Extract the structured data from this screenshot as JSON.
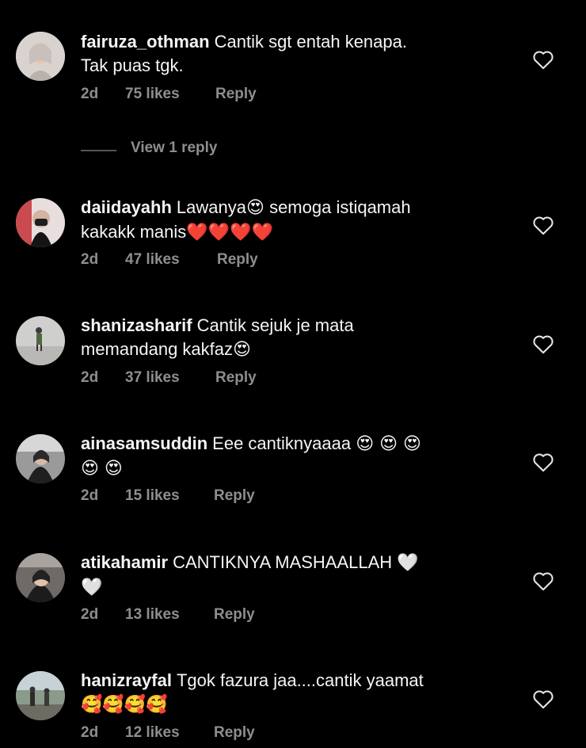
{
  "comments": [
    {
      "username": "fairuza_othman",
      "text_before": "Cantik sgt entah kenapa.",
      "text_after": "Tak puas tgk.",
      "emoji_inline": "",
      "emoji_tail": "",
      "time": "2d",
      "likes": "75 likes",
      "reply": "Reply",
      "avatar_icon": "profile-photo",
      "like_icon": "heart-outline-icon"
    },
    {
      "username": "daiidayahh",
      "text_before": "Lawanya",
      "emoji_inline": "😍",
      "text_after": "semoga istiqamah",
      "line2_text": "kakakk manis",
      "emoji_tail": "❤️❤️❤️❤️",
      "time": "2d",
      "likes": "47 likes",
      "reply": "Reply",
      "avatar_icon": "profile-photo",
      "like_icon": "heart-outline-icon"
    },
    {
      "username": "shanizasharif",
      "text_before": "Cantik sejuk je mata",
      "line2_text": "memandang kakfaz",
      "emoji_tail": "😍",
      "time": "2d",
      "likes": "37 likes",
      "reply": "Reply",
      "avatar_icon": "profile-photo",
      "like_icon": "heart-outline-icon"
    },
    {
      "username": "ainasamsuddin",
      "text_before": "Eee cantiknyaaaa",
      "emoji_inline": "😍 😍 😍",
      "emoji_tail": "😍 😍",
      "time": "2d",
      "likes": "15 likes",
      "reply": "Reply",
      "avatar_icon": "profile-photo",
      "like_icon": "heart-outline-icon"
    },
    {
      "username": "atikahamir",
      "text_before": "CANTIKNYA MASHAALLAH",
      "emoji_inline": "🤍",
      "emoji_tail": "🤍",
      "time": "2d",
      "likes": "13 likes",
      "reply": "Reply",
      "avatar_icon": "profile-photo",
      "like_icon": "heart-outline-icon"
    },
    {
      "username": "hanizrayfal",
      "text_before": "Tgok fazura jaa....cantik yaamat",
      "emoji_tail": "🥰🥰🥰🥰",
      "time": "2d",
      "likes": "12 likes",
      "reply": "Reply",
      "avatar_icon": "profile-photo",
      "like_icon": "heart-outline-icon"
    }
  ],
  "view_replies": {
    "label": "View 1 reply"
  },
  "colors": {
    "background": "#000000",
    "text": "#f5f5f5",
    "meta": "#8e8e8e"
  }
}
